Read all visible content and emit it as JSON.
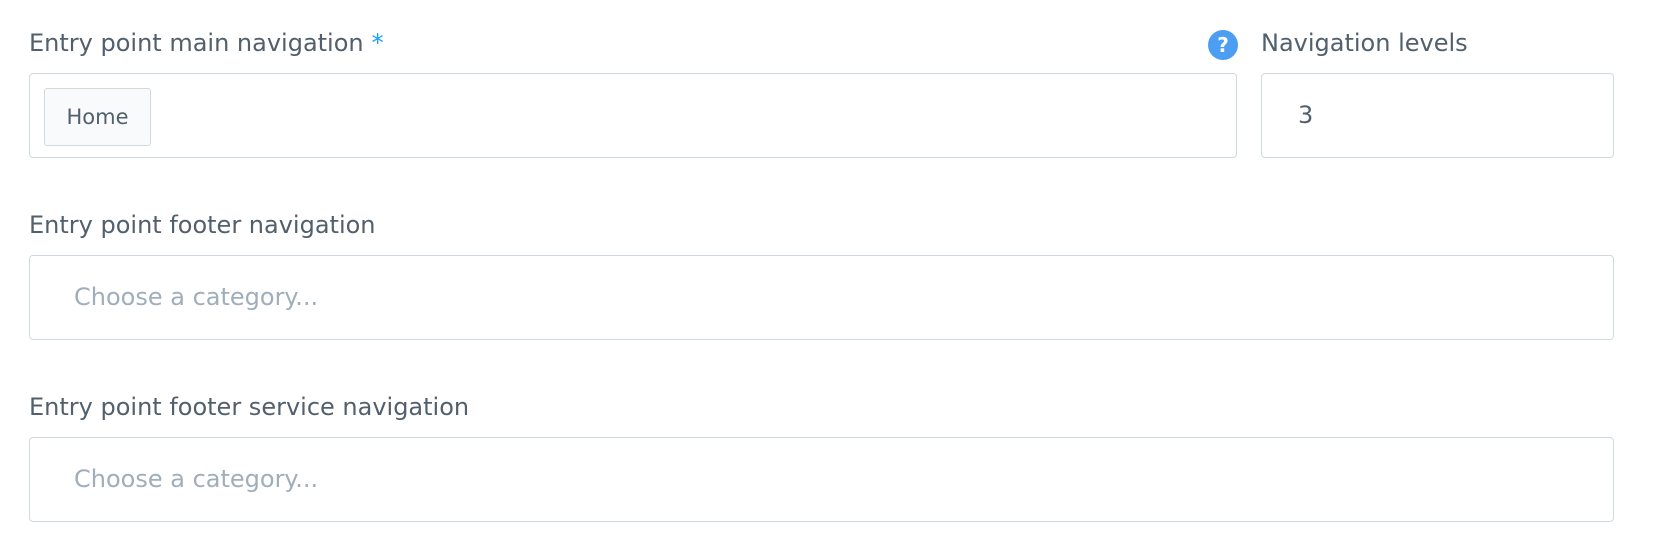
{
  "main_navigation": {
    "label": "Entry point main navigation",
    "required_marker": "*",
    "help_symbol": "?",
    "help_icon": "question-circle-icon",
    "selected_tag": "Home"
  },
  "navigation_levels": {
    "label": "Navigation levels",
    "value": "3"
  },
  "footer_navigation": {
    "label": "Entry point footer navigation",
    "placeholder": "Choose a category..."
  },
  "footer_service_navigation": {
    "label": "Entry point footer service navigation",
    "placeholder": "Choose a category..."
  },
  "colors": {
    "accent": "#189eff",
    "help_icon": "#4b9ef2",
    "border": "#d1d9e0",
    "label_text": "#52606d",
    "placeholder_text": "#a0aebc"
  }
}
